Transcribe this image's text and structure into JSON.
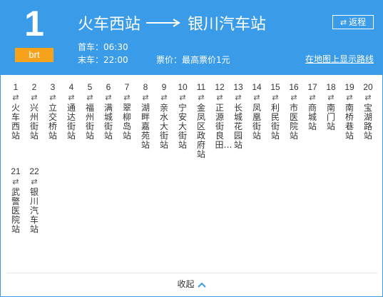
{
  "route": {
    "number": "1",
    "tag": "brt",
    "origin": "火车西站",
    "destination": "银川汽车站",
    "first_bus": "首车：06:30",
    "last_bus": "末车：22:00",
    "fare": "票价：最高票价1元",
    "map_link": "在地图上显示路线",
    "return_label": "返程"
  },
  "stops": [
    {
      "num": "1",
      "name": "火车西站"
    },
    {
      "num": "2",
      "name": "兴州街站"
    },
    {
      "num": "3",
      "name": "立交桥站"
    },
    {
      "num": "4",
      "name": "通达街站"
    },
    {
      "num": "5",
      "name": "福州街站"
    },
    {
      "num": "6",
      "name": "满城街站"
    },
    {
      "num": "7",
      "name": "翠柳岛站"
    },
    {
      "num": "8",
      "name": "湖畔嘉苑站"
    },
    {
      "num": "9",
      "name": "亲水大街站"
    },
    {
      "num": "10",
      "name": "宁安大街站"
    },
    {
      "num": "11",
      "name": "金凤区政府站"
    },
    {
      "num": "12",
      "name": "正源街良田…"
    },
    {
      "num": "13",
      "name": "长城花园站"
    },
    {
      "num": "14",
      "name": "凤凰街站"
    },
    {
      "num": "15",
      "name": "利民街站"
    },
    {
      "num": "16",
      "name": "市医院站"
    },
    {
      "num": "17",
      "name": "商城站"
    },
    {
      "num": "18",
      "name": "南门站"
    },
    {
      "num": "19",
      "name": "南桥巷站"
    },
    {
      "num": "20",
      "name": "宝湖路站"
    },
    {
      "num": "21",
      "name": "武警医院站"
    },
    {
      "num": "22",
      "name": "银川汽车站"
    }
  ],
  "footer": {
    "collapse_label": "收起"
  },
  "icons": {
    "swap": "⇄"
  },
  "colors": {
    "header_bg": "#3a9be8",
    "tag_bg": "#f7a21b",
    "chevron": "#3a9be8"
  }
}
